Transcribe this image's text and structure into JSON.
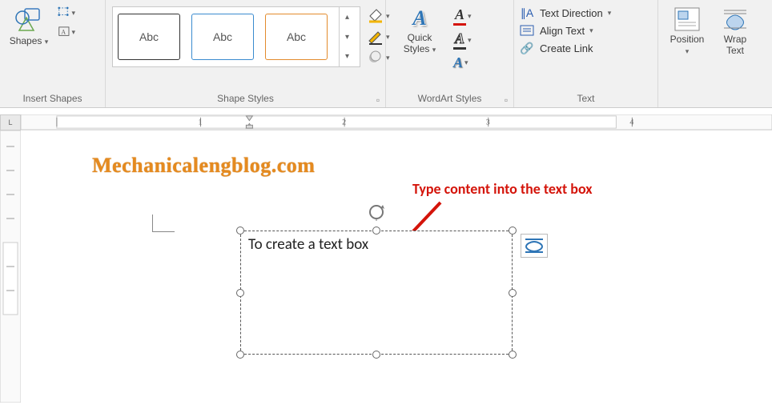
{
  "ribbon": {
    "groups": {
      "insert_shapes": {
        "label": "Insert Shapes",
        "shapes_btn": "Shapes"
      },
      "shape_styles": {
        "label": "Shape Styles",
        "thumb_text": "Abc"
      },
      "wordart": {
        "label": "WordArt Styles"
      },
      "text": {
        "label": "Text",
        "direction": "Text Direction",
        "align": "Align Text",
        "link": "Create Link"
      },
      "arrange": {
        "position": "Position",
        "wrap": "Wrap Text"
      }
    }
  },
  "ruler": {
    "marks": [
      "1",
      "2",
      "3",
      "4"
    ]
  },
  "doc": {
    "watermark": "Mechanicalengblog.com",
    "annotation": "Type content into the text box",
    "textbox_content": "To create a text box"
  }
}
